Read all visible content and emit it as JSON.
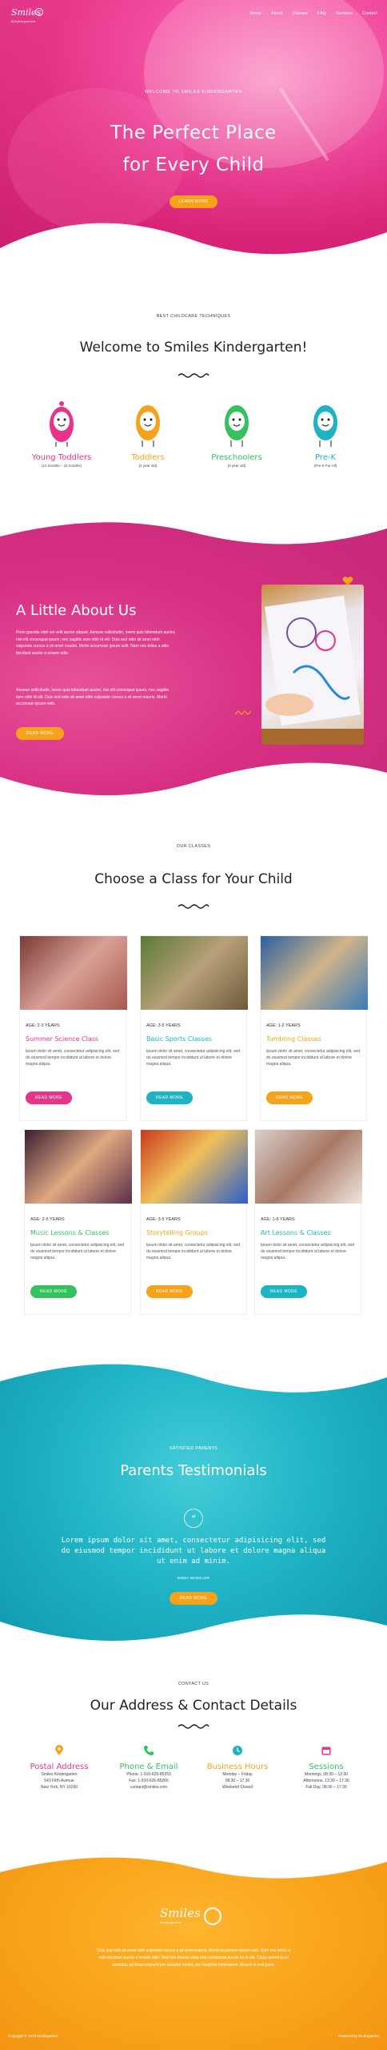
{
  "nav": {
    "logo_text": "Smiles",
    "logo_sub": "Kindergarten",
    "menu": [
      "Home",
      "About",
      "Classes",
      "FAQ",
      "Services",
      "Contact"
    ]
  },
  "hero": {
    "eyebrow": "WELCOME TO SMILES KINDERGARTEN",
    "title_line1": "The Perfect Place",
    "title_line2": "for Every Child",
    "button": "LEARN MORE"
  },
  "welcome": {
    "eyebrow": "BEST CHILDCARE TECHNIQUES",
    "title": "Welcome to Smiles Kindergarten!",
    "programs": [
      {
        "label": "Young Toddlers",
        "age": "(12 months – 23 months)",
        "color": "#e8338a"
      },
      {
        "label": "Toddlers",
        "age": "(2 year old)",
        "color": "#f7a21b"
      },
      {
        "label": "Preschoolers",
        "age": "(3 year old)",
        "color": "#33c25e"
      },
      {
        "label": "Pre-K",
        "age": "(Pre-K For All)",
        "color": "#1eb3c4"
      }
    ]
  },
  "about": {
    "title": "A Little About Us",
    "p1": "Proin gravida nibh vel velit auctor aliquet. Aenean sollicitudin, lorem quis bibendum auctor, nisi elit consequat ipsum, nec sagittis sem nibh id elit. Duis sed odio sit amet nibh vulputate cursus a sit amet mauris. Morbi accumsan ipsum velit. Nam nec tellus a odio tincidunt auctor a ornare odio.",
    "p2": "Aenean sollicitudin, lorem quis bibendum auctor, nisi elit consequat ipsum, nec sagittis sem nibh id elit. Duis sed odio sit amet nibh vulputate cursus a sit amet mauris. Morbi accumsan ipsum velit.",
    "button": "READ MORE"
  },
  "classes": {
    "eyebrow": "OUR CLASSES",
    "title": "Choose a Class for Your Child",
    "items": [
      {
        "age": "AGE: 2-3 YEARS",
        "title": "Summer Science Class",
        "color": "#e8338a",
        "text": "Ipsum dolor sit amet, consectetur adipisicing elit, sed do eiusmod tempor incididunt ut labore et dolore magna aliqua.",
        "button": "READ MORE"
      },
      {
        "age": "AGE: 3-5 YEARS",
        "title": "Basic Sports Classes",
        "color": "#1eb3c4",
        "text": "Ipsum dolor sit amet, consectetur adipisicing elit, sed do eiusmod tempor incididunt ut labore et dolore magna aliqua.",
        "button": "READ MORE"
      },
      {
        "age": "AGE: 1-2 YEARS",
        "title": "Tumbling Classes",
        "color": "#f7a21b",
        "text": "Ipsum dolor sit amet, consectetur adipisicing elit, sed do eiusmod tempor incididunt ut labore et dolore magna aliqua.",
        "button": "READ MORE"
      },
      {
        "age": "AGE: 2-5 YEARS",
        "title": "Music Lessons & Classes",
        "color": "#33c25e",
        "text": "Ipsum dolor sit amet, consectetur adipisicing elit, sed do eiusmod tempor incididunt ut labore et dolore magna aliqua.",
        "button": "READ MORE"
      },
      {
        "age": "AGE: 3-5 YEARS",
        "title": "Storytelling Groups",
        "color": "#f7a21b",
        "text": "Ipsum dolor sit amet, consectetur adipisicing elit, sed do eiusmod tempor incididunt ut labore et dolore magna aliqua.",
        "button": "READ MORE"
      },
      {
        "age": "AGE: 1-6 YEARS",
        "title": "Art Lessons & Classes",
        "color": "#1eb3c4",
        "text": "Ipsum dolor sit amet, consectetur adipisicing elit, sed do eiusmod tempor incididunt ut labore et dolore magna aliqua.",
        "button": "READ MORE"
      }
    ]
  },
  "testimonials": {
    "eyebrow": "SATISFIED PARENTS",
    "title": "Parents Testimonials",
    "quote_mark": "“",
    "quote": "Lorem ipsum dolor sit amet, consectetur adipisicing elit, sed do eiusmod tempor incididunt ut labore et dolore magna aliqua ut enim ad minim.",
    "author": "EMMA WHEELER",
    "button": "READ MORE"
  },
  "contact": {
    "eyebrow": "CONTACT US",
    "title": "Our Address & Contact Details",
    "blocks": [
      {
        "title": "Postal Address",
        "icon": "map-pin-icon",
        "color": "#e8338a",
        "lines": [
          "Smiles Kindergarten",
          "543 Fifth Avenue",
          "New York, NY 10160"
        ]
      },
      {
        "title": "Phone & Email",
        "icon": "phone-icon",
        "color": "#33c25e",
        "lines": [
          "Phone: 1-910-626-85253",
          "Fax: 1-910-626-85266",
          "contact@smiles.com"
        ]
      },
      {
        "title": "Business Hours",
        "icon": "clock-icon",
        "color": "#1eb3c4",
        "lines": [
          "Monday – Friday",
          "08:30 – 17:30",
          "Weekend Closed"
        ]
      },
      {
        "title": "Sessions",
        "icon": "calendar-icon",
        "color": "#e8338a",
        "lines": [
          "Mornings, 08:30 – 12:30",
          "Afternoons, 13:30 – 17:30",
          "Full Day, 08:30 – 17:30"
        ]
      }
    ]
  },
  "footer": {
    "logo_text": "Smiles",
    "logo_sub": "Kindergarten",
    "text": "Duis sed odio sit amet nibh vulputate cursus a sit amet mauris. Morbi accumsan ipsum velit. Nam nec tellus a odio tincidunt auctor a ornare odio. Sed non mauris vitae erat consequat auctor eu in elit. Class aptent taciti sociosqu ad litora torquent per conubia nostra, per inceptos himenaeos. Mauris in erat justo.",
    "copyright": "Copyright © 2019 Kindergarten",
    "powered": "Powered by Kindergarten"
  }
}
